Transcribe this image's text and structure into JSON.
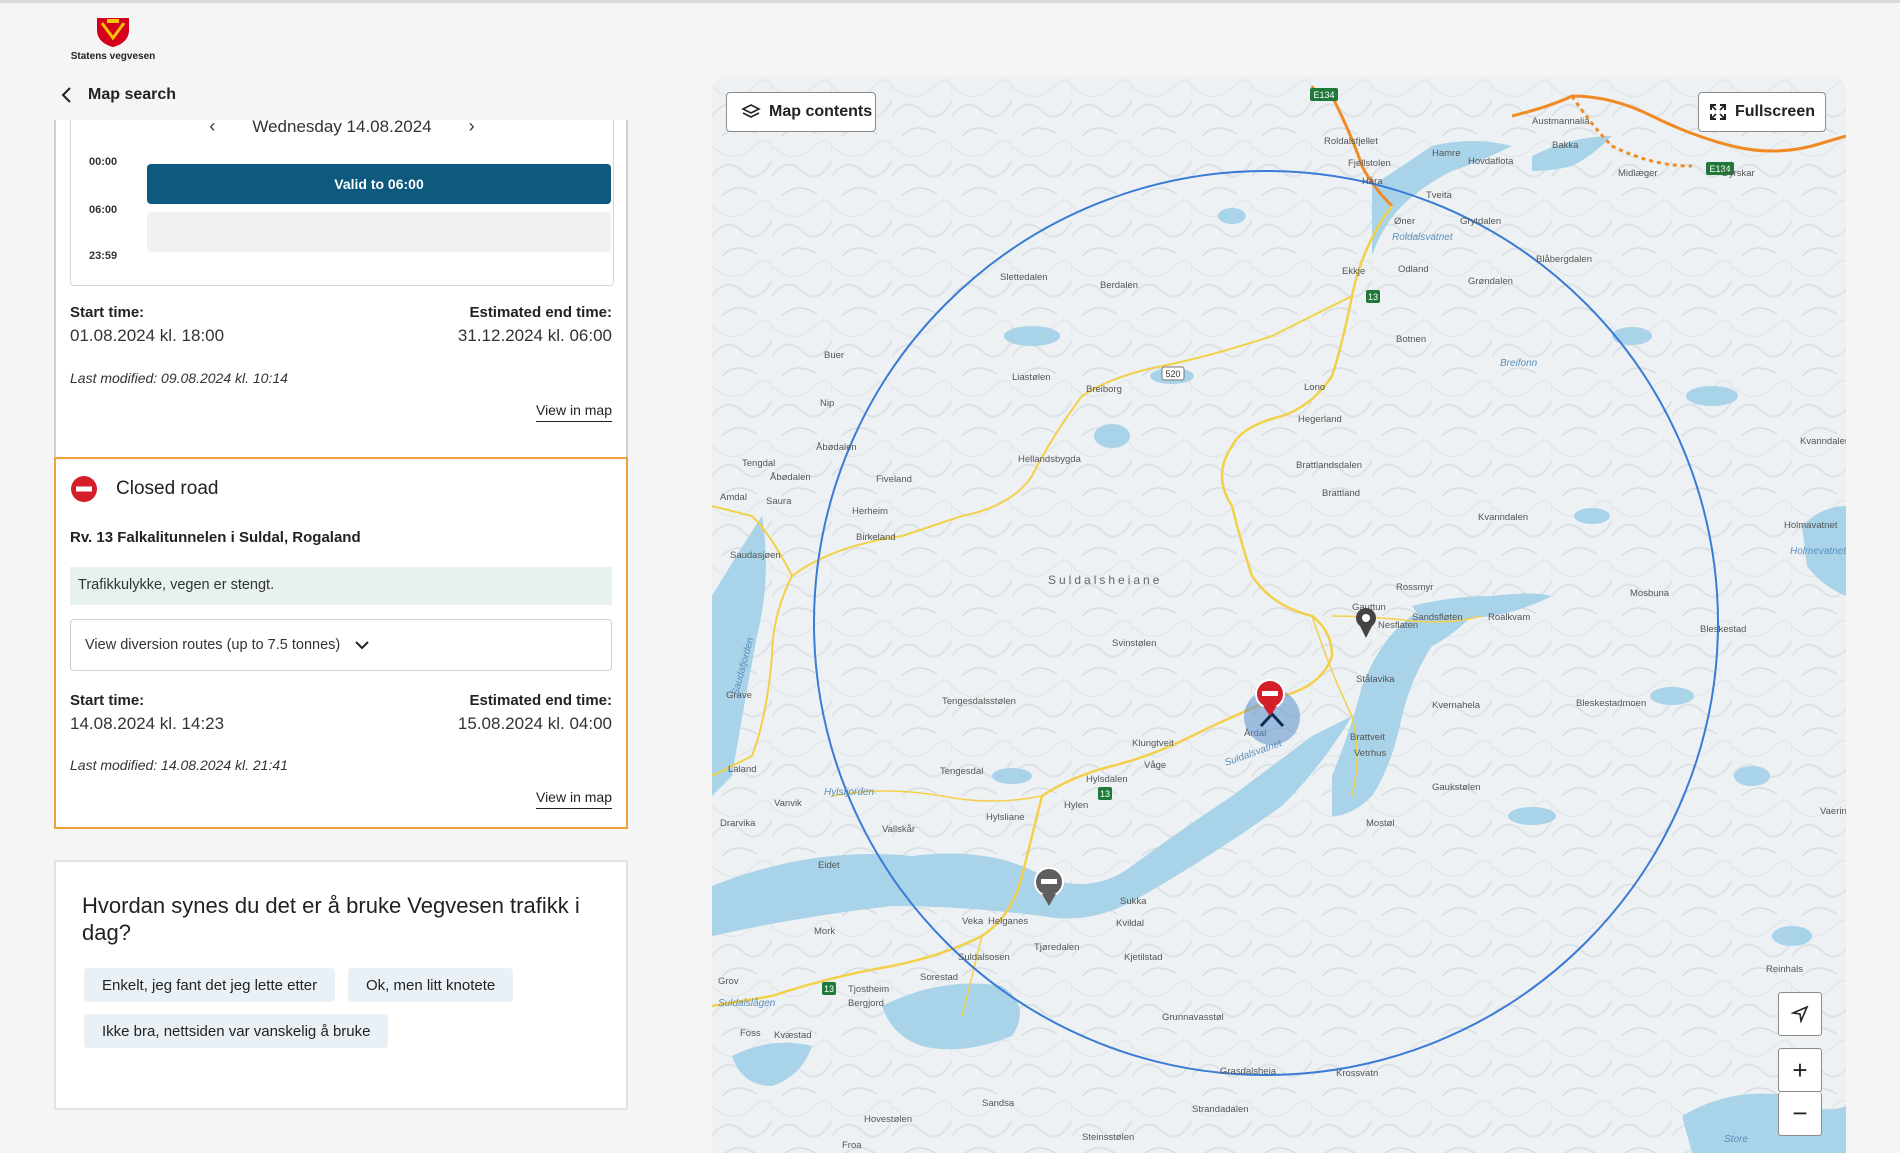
{
  "brand": {
    "name": "Statens vegvesen"
  },
  "nav": {
    "back_label": "Map search"
  },
  "card_previous": {
    "date": "Wednesday 14.08.2024",
    "times": [
      "00:00",
      "06:00",
      "23:59"
    ],
    "valid_label": "Valid to 06:00",
    "start_label": "Start time:",
    "start_value": "01.08.2024 kl. 18:00",
    "end_label": "Estimated end time:",
    "end_value": "31.12.2024 kl. 06:00",
    "last_modified": "Last modified: 09.08.2024 kl. 10:14",
    "view_in_map": "View in map"
  },
  "card_closed": {
    "type_label": "Closed road",
    "road": "Rv. 13 Falkalitunnelen i Suldal, Rogaland",
    "note": "Trafikkulykke, vegen er stengt.",
    "diversion_label": "View diversion routes (up to 7.5 tonnes)",
    "start_label": "Start time:",
    "start_value": "14.08.2024 kl. 14:23",
    "end_label": "Estimated end time:",
    "end_value": "15.08.2024 kl. 04:00",
    "last_modified": "Last modified: 14.08.2024 kl. 21:41",
    "view_in_map": "View in map"
  },
  "survey": {
    "title": "Hvordan synes du det er å bruke Vegvesen trafikk i dag?",
    "options": [
      "Enkelt, jeg fant det jeg lette etter",
      "Ok, men litt knotete",
      "Ikke bra, nettsiden var vanskelig å bruke"
    ]
  },
  "map": {
    "contents_label": "Map contents",
    "fullscreen_label": "Fullscreen",
    "zoom_in": "+",
    "zoom_out": "−",
    "road_shields": [
      "E134",
      "E134",
      "13",
      "13",
      "13",
      "520"
    ],
    "places": [
      "Roldalsfjellet",
      "Håra",
      "Hamre",
      "Hovdaflota",
      "Austmannalia",
      "Bakka",
      "Midlæger",
      "Dyrskar",
      "Grytdalen",
      "Øner",
      "Tveita",
      "Odland",
      "Grøndalen",
      "Blåbergdalen",
      "Breifonn",
      "Botnen",
      "Ekkje",
      "Berdalen",
      "Slettedalen",
      "Fjellstolen",
      "Lono",
      "Hegerland",
      "Breiborg",
      "Liastølen",
      "Buer",
      "Nip",
      "Åbødalen",
      "Fiveland",
      "Hellandsbygda",
      "Tengdal",
      "Åbødalen",
      "Amdal",
      "Saura",
      "Herheim",
      "Birkeland",
      "Saudasjøen",
      "Brattlandsdalen",
      "Brattland",
      "Kvanndalen",
      "Rossmyr",
      "Gauttun",
      "Sandsfløten",
      "Roalkvam",
      "Nesflaten",
      "Mosbuna",
      "Bleskestad",
      "Suldalsheiane",
      "Svinstølen",
      "Stålavika",
      "Kvernahela",
      "Bleskestadmoen",
      "Tengesdalsstølen",
      "Grave",
      "Klungtveit",
      "Våge",
      "Årdal",
      "Brattveit",
      "Vetrhus",
      "Tengesdal",
      "Hylsdalen",
      "Hylen",
      "Hylsliane",
      "Laland",
      "Vanvik",
      "Drarvika",
      "Vallskår",
      "Eidet",
      "Gaukstølen",
      "Mostøl",
      "Mork",
      "Veka",
      "Helganes",
      "Tjøredalen",
      "Sukka",
      "Kvildal",
      "Suldalsosen",
      "Sorestad",
      "Tjostheim",
      "Bergjord",
      "Kjetilstad",
      "Grov",
      "Foss",
      "Kvæstad",
      "Grunnavasstøl",
      "Grasdalsheia",
      "Krossvatn",
      "Reinhals",
      "Vaering",
      "Sandsa",
      "Strandadalen",
      "Hovestølen",
      "Steinsstølen",
      "Froa",
      "Saudafjorden",
      "Suldalsvatnet",
      "Hylsfjorden",
      "Suldalslågen",
      "Roldalsvatnet",
      "Holmavatnet",
      "Store",
      "Kvanndalen",
      "Holmevatnet"
    ]
  }
}
